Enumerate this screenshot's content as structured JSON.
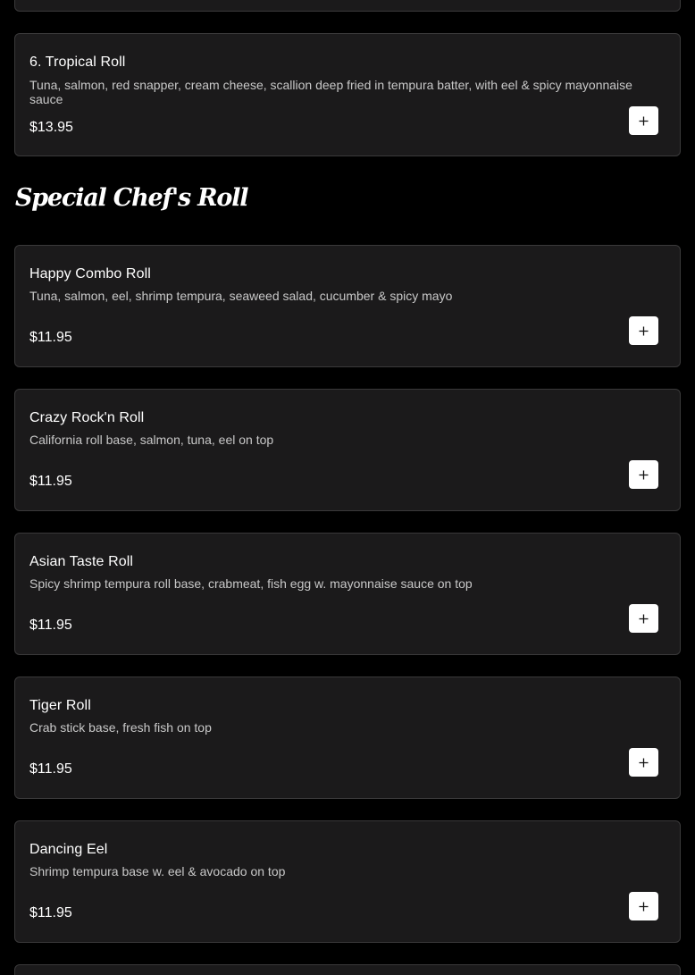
{
  "section": {
    "title": "Special Chef's Roll"
  },
  "items": [
    {
      "name": "6. Tropical Roll",
      "description": "Tuna, salmon, red snapper, cream cheese, scallion deep fried in tempura batter, with eel & spicy mayonnaise sauce",
      "price": "$13.95"
    },
    {
      "name": "Happy Combo Roll",
      "description": "Tuna, salmon, eel, shrimp tempura, seaweed salad, cucumber & spicy mayo",
      "price": "$11.95"
    },
    {
      "name": "Crazy Rock'n Roll",
      "description": "California roll base, salmon, tuna, eel on top",
      "price": "$11.95"
    },
    {
      "name": "Asian Taste Roll",
      "description": "Spicy shrimp tempura roll base, crabmeat, fish egg w. mayonnaise sauce on top",
      "price": "$11.95"
    },
    {
      "name": "Tiger Roll",
      "description": "Crab stick base, fresh fish on top",
      "price": "$11.95"
    },
    {
      "name": "Dancing Eel",
      "description": "Shrimp tempura base w. eel & avocado on top",
      "price": "$11.95"
    }
  ],
  "colors": {
    "background": "#000000",
    "card": "#1b1a1b",
    "card_border": "#3a393a",
    "button": "#ffffff"
  },
  "icons": {
    "add": "plus-icon"
  }
}
